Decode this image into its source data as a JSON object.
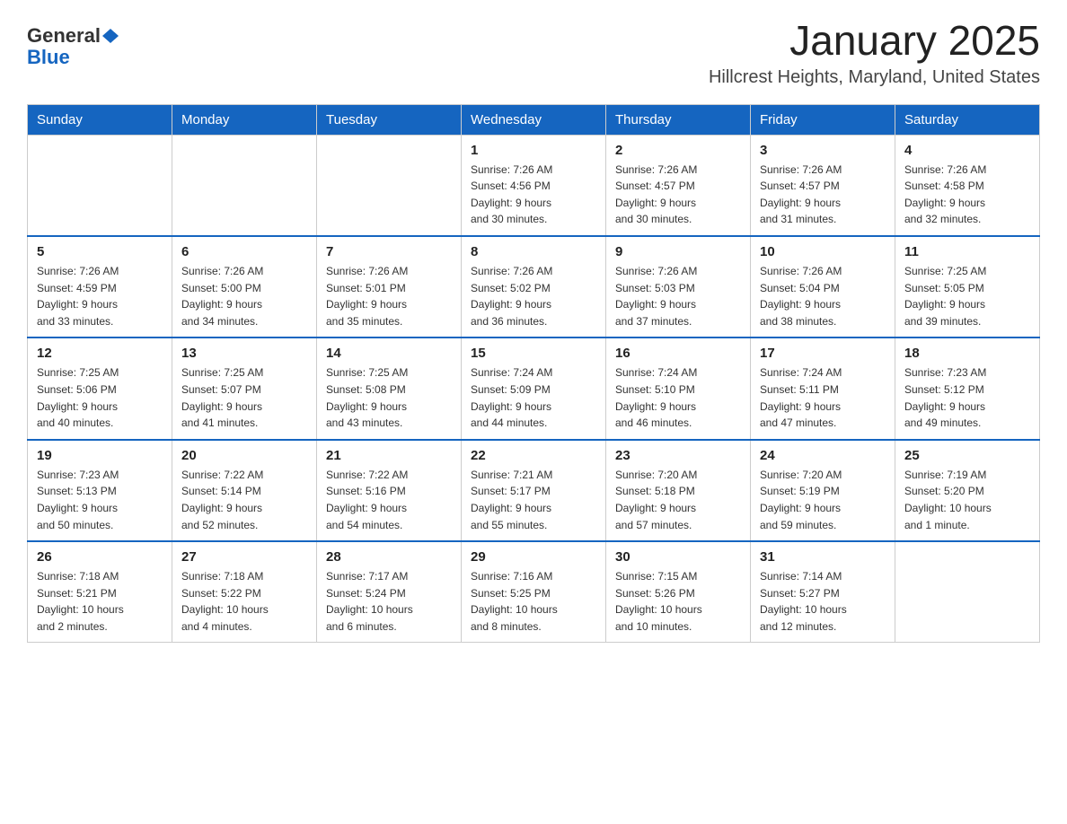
{
  "logo": {
    "general": "General",
    "blue": "Blue"
  },
  "title": "January 2025",
  "subtitle": "Hillcrest Heights, Maryland, United States",
  "days_of_week": [
    "Sunday",
    "Monday",
    "Tuesday",
    "Wednesday",
    "Thursday",
    "Friday",
    "Saturday"
  ],
  "weeks": [
    [
      {
        "day": "",
        "info": ""
      },
      {
        "day": "",
        "info": ""
      },
      {
        "day": "",
        "info": ""
      },
      {
        "day": "1",
        "info": "Sunrise: 7:26 AM\nSunset: 4:56 PM\nDaylight: 9 hours\nand 30 minutes."
      },
      {
        "day": "2",
        "info": "Sunrise: 7:26 AM\nSunset: 4:57 PM\nDaylight: 9 hours\nand 30 minutes."
      },
      {
        "day": "3",
        "info": "Sunrise: 7:26 AM\nSunset: 4:57 PM\nDaylight: 9 hours\nand 31 minutes."
      },
      {
        "day": "4",
        "info": "Sunrise: 7:26 AM\nSunset: 4:58 PM\nDaylight: 9 hours\nand 32 minutes."
      }
    ],
    [
      {
        "day": "5",
        "info": "Sunrise: 7:26 AM\nSunset: 4:59 PM\nDaylight: 9 hours\nand 33 minutes."
      },
      {
        "day": "6",
        "info": "Sunrise: 7:26 AM\nSunset: 5:00 PM\nDaylight: 9 hours\nand 34 minutes."
      },
      {
        "day": "7",
        "info": "Sunrise: 7:26 AM\nSunset: 5:01 PM\nDaylight: 9 hours\nand 35 minutes."
      },
      {
        "day": "8",
        "info": "Sunrise: 7:26 AM\nSunset: 5:02 PM\nDaylight: 9 hours\nand 36 minutes."
      },
      {
        "day": "9",
        "info": "Sunrise: 7:26 AM\nSunset: 5:03 PM\nDaylight: 9 hours\nand 37 minutes."
      },
      {
        "day": "10",
        "info": "Sunrise: 7:26 AM\nSunset: 5:04 PM\nDaylight: 9 hours\nand 38 minutes."
      },
      {
        "day": "11",
        "info": "Sunrise: 7:25 AM\nSunset: 5:05 PM\nDaylight: 9 hours\nand 39 minutes."
      }
    ],
    [
      {
        "day": "12",
        "info": "Sunrise: 7:25 AM\nSunset: 5:06 PM\nDaylight: 9 hours\nand 40 minutes."
      },
      {
        "day": "13",
        "info": "Sunrise: 7:25 AM\nSunset: 5:07 PM\nDaylight: 9 hours\nand 41 minutes."
      },
      {
        "day": "14",
        "info": "Sunrise: 7:25 AM\nSunset: 5:08 PM\nDaylight: 9 hours\nand 43 minutes."
      },
      {
        "day": "15",
        "info": "Sunrise: 7:24 AM\nSunset: 5:09 PM\nDaylight: 9 hours\nand 44 minutes."
      },
      {
        "day": "16",
        "info": "Sunrise: 7:24 AM\nSunset: 5:10 PM\nDaylight: 9 hours\nand 46 minutes."
      },
      {
        "day": "17",
        "info": "Sunrise: 7:24 AM\nSunset: 5:11 PM\nDaylight: 9 hours\nand 47 minutes."
      },
      {
        "day": "18",
        "info": "Sunrise: 7:23 AM\nSunset: 5:12 PM\nDaylight: 9 hours\nand 49 minutes."
      }
    ],
    [
      {
        "day": "19",
        "info": "Sunrise: 7:23 AM\nSunset: 5:13 PM\nDaylight: 9 hours\nand 50 minutes."
      },
      {
        "day": "20",
        "info": "Sunrise: 7:22 AM\nSunset: 5:14 PM\nDaylight: 9 hours\nand 52 minutes."
      },
      {
        "day": "21",
        "info": "Sunrise: 7:22 AM\nSunset: 5:16 PM\nDaylight: 9 hours\nand 54 minutes."
      },
      {
        "day": "22",
        "info": "Sunrise: 7:21 AM\nSunset: 5:17 PM\nDaylight: 9 hours\nand 55 minutes."
      },
      {
        "day": "23",
        "info": "Sunrise: 7:20 AM\nSunset: 5:18 PM\nDaylight: 9 hours\nand 57 minutes."
      },
      {
        "day": "24",
        "info": "Sunrise: 7:20 AM\nSunset: 5:19 PM\nDaylight: 9 hours\nand 59 minutes."
      },
      {
        "day": "25",
        "info": "Sunrise: 7:19 AM\nSunset: 5:20 PM\nDaylight: 10 hours\nand 1 minute."
      }
    ],
    [
      {
        "day": "26",
        "info": "Sunrise: 7:18 AM\nSunset: 5:21 PM\nDaylight: 10 hours\nand 2 minutes."
      },
      {
        "day": "27",
        "info": "Sunrise: 7:18 AM\nSunset: 5:22 PM\nDaylight: 10 hours\nand 4 minutes."
      },
      {
        "day": "28",
        "info": "Sunrise: 7:17 AM\nSunset: 5:24 PM\nDaylight: 10 hours\nand 6 minutes."
      },
      {
        "day": "29",
        "info": "Sunrise: 7:16 AM\nSunset: 5:25 PM\nDaylight: 10 hours\nand 8 minutes."
      },
      {
        "day": "30",
        "info": "Sunrise: 7:15 AM\nSunset: 5:26 PM\nDaylight: 10 hours\nand 10 minutes."
      },
      {
        "day": "31",
        "info": "Sunrise: 7:14 AM\nSunset: 5:27 PM\nDaylight: 10 hours\nand 12 minutes."
      },
      {
        "day": "",
        "info": ""
      }
    ]
  ]
}
